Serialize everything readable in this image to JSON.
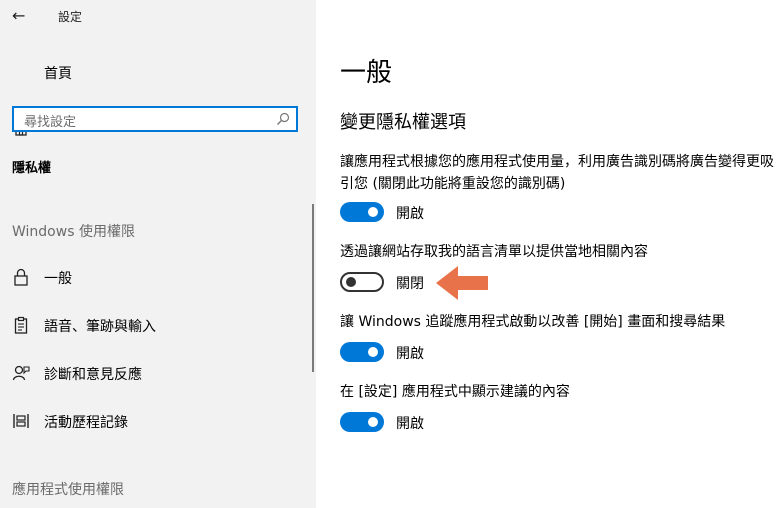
{
  "window": {
    "title": "設定",
    "back_glyph": "←"
  },
  "sidebar": {
    "home_label": "首頁",
    "search_placeholder": "尋找設定",
    "category": "隱私權",
    "section_windows": "Windows 使用權限",
    "items": [
      {
        "label": "一般",
        "icon": "lock-icon"
      },
      {
        "label": "語音、筆跡與輸入",
        "icon": "clipboard-icon"
      },
      {
        "label": "診斷和意見反應",
        "icon": "feedback-icon"
      },
      {
        "label": "活動歷程記錄",
        "icon": "timeline-icon"
      }
    ],
    "section_apps": "應用程式使用權限"
  },
  "main": {
    "title": "一般",
    "subtitle": "變更隱私權選項",
    "options": [
      {
        "text": "讓應用程式根據您的應用程式使用量，利用廣告識別碼將廣告變得更吸引您 (關閉此功能將重設您的識別碼)",
        "state": "開啟",
        "on": true
      },
      {
        "text": "透過讓網站存取我的語言清單以提供當地相關內容",
        "state": "關閉",
        "on": false
      },
      {
        "text": "讓 Windows 追蹤應用程式啟動以改善 [開始] 畫面和搜尋結果",
        "state": "開啟",
        "on": true
      },
      {
        "text": "在 [設定] 應用程式中顯示建議的內容",
        "state": "開啟",
        "on": true
      }
    ]
  },
  "colors": {
    "accent": "#0078d7",
    "arrow": "#e8734a",
    "sidebar_bg": "#f2f2f2"
  }
}
